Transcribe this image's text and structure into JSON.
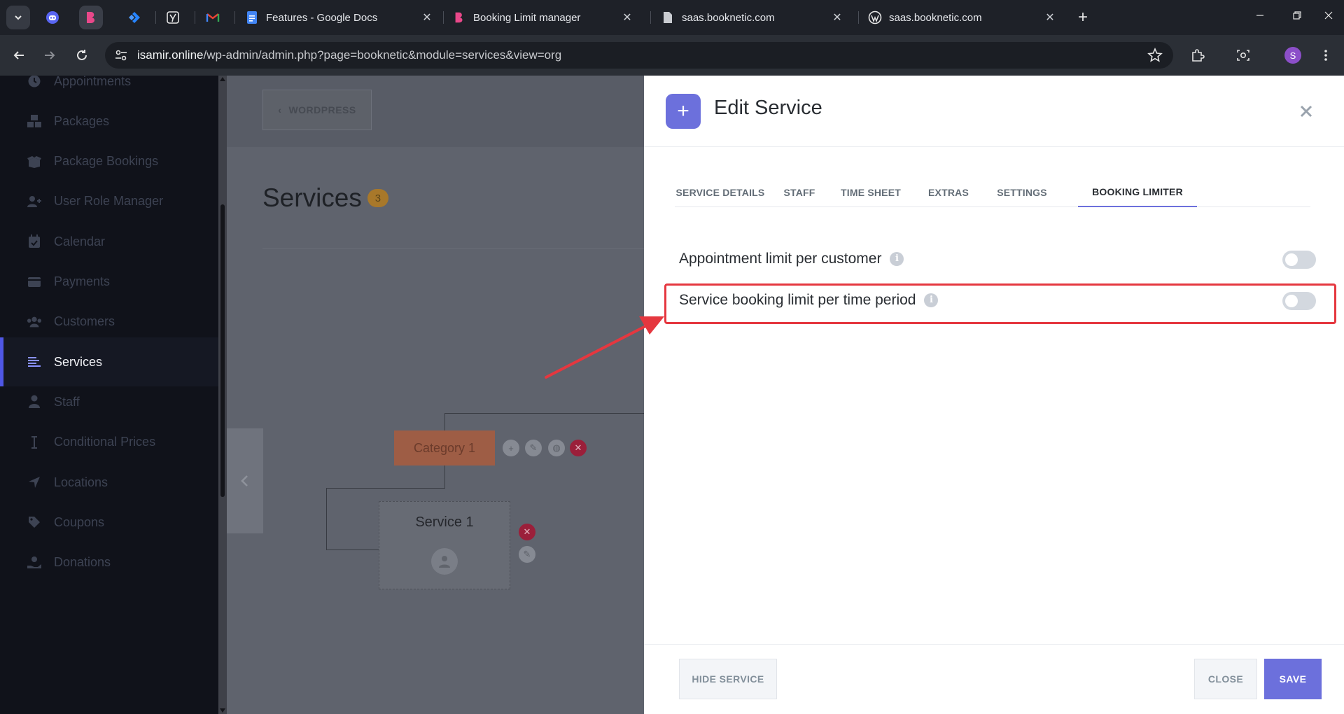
{
  "browser": {
    "tabs": [
      {
        "title": "Features - Google Docs"
      },
      {
        "title": "Booking Limit manager"
      },
      {
        "title": "saas.booknetic.com"
      },
      {
        "title": "saas.booknetic.com"
      }
    ],
    "url_host": "isamir.online",
    "url_path": "/wp-admin/admin.php?page=booknetic&module=services&view=org",
    "profile_initial": "S"
  },
  "sidebar": {
    "items": [
      {
        "label": "Appointments",
        "icon": "clock-icon"
      },
      {
        "label": "Packages",
        "icon": "boxes-icon"
      },
      {
        "label": "Package Bookings",
        "icon": "box-open-icon"
      },
      {
        "label": "User Role Manager",
        "icon": "user-plus-icon"
      },
      {
        "label": "Calendar",
        "icon": "calendar-icon"
      },
      {
        "label": "Payments",
        "icon": "wallet-icon"
      },
      {
        "label": "Customers",
        "icon": "users-icon"
      },
      {
        "label": "Services",
        "icon": "list-icon",
        "active": true
      },
      {
        "label": "Staff",
        "icon": "user-icon"
      },
      {
        "label": "Conditional Prices",
        "icon": "cursor-icon"
      },
      {
        "label": "Locations",
        "icon": "location-arrow-icon"
      },
      {
        "label": "Coupons",
        "icon": "tag-icon"
      },
      {
        "label": "Donations",
        "icon": "hand-holding-icon"
      }
    ]
  },
  "main": {
    "wordpress_label": "WORDPRESS",
    "title": "Services",
    "count": "3",
    "category_label": "Category 1",
    "service_label": "Service 1"
  },
  "panel": {
    "title": "Edit Service",
    "tabs": [
      {
        "label": "SERVICE DETAILS"
      },
      {
        "label": "STAFF"
      },
      {
        "label": "TIME SHEET"
      },
      {
        "label": "EXTRAS"
      },
      {
        "label": "SETTINGS"
      },
      {
        "label": "BOOKING LIMITER",
        "active": true
      }
    ],
    "settings": [
      {
        "label": "Appointment limit per customer",
        "enabled": false
      },
      {
        "label": "Service booking limit per time period",
        "enabled": false
      }
    ],
    "hide_label": "HIDE SERVICE",
    "close_label": "CLOSE",
    "save_label": "SAVE"
  },
  "colors": {
    "accent": "#6c70dc",
    "sidebar_bg": "#10121a",
    "highlight": "#e5373f",
    "category_orange": "#e86f4b"
  }
}
